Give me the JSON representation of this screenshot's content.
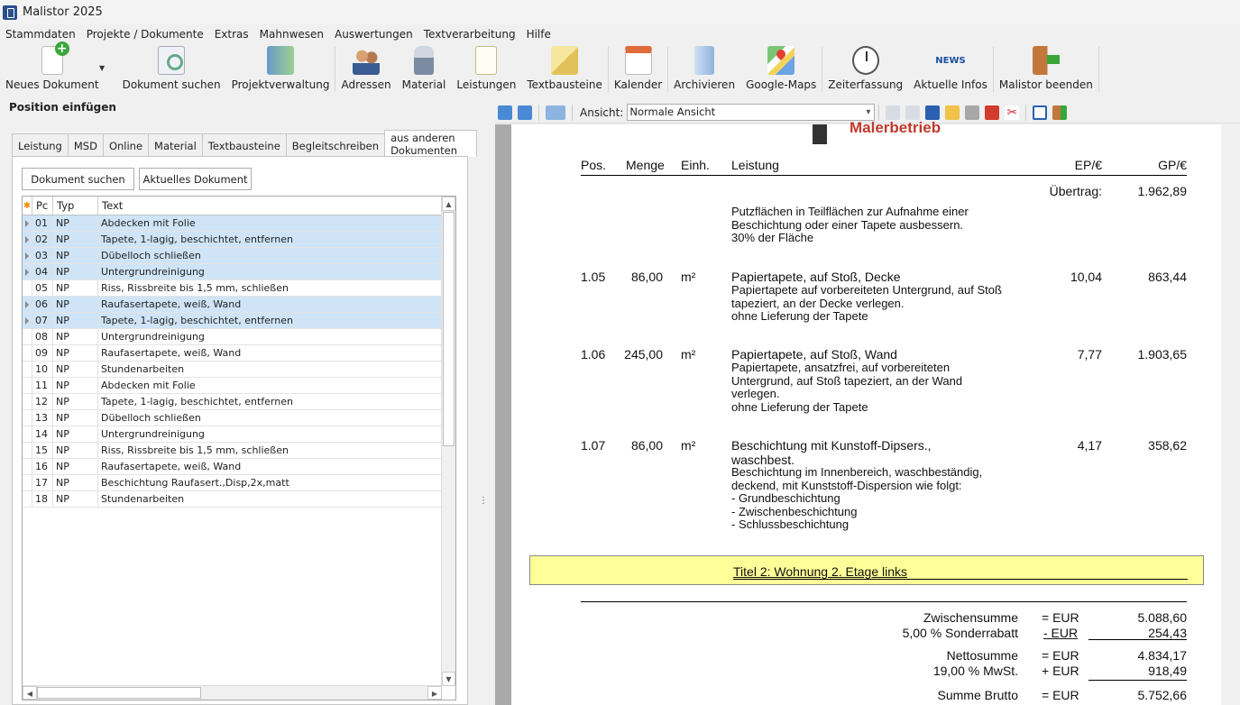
{
  "window": {
    "title": "Malistor 2025"
  },
  "menu": [
    "Stammdaten",
    "Projekte / Dokumente",
    "Extras",
    "Mahnwesen",
    "Auswertungen",
    "Textverarbeitung",
    "Hilfe"
  ],
  "ribbon": {
    "new_doc": "Neues Dokument",
    "search_doc": "Dokument suchen",
    "projects": "Projektverwaltung",
    "addresses": "Adressen",
    "material": "Material",
    "services": "Leistungen",
    "textblocks": "Textbausteine",
    "calendar": "Kalender",
    "archive": "Archivieren",
    "maps": "Google-Maps",
    "time": "Zeiterfassung",
    "news": "Aktuelle Infos",
    "news_icon": "NEWS",
    "exit": "Malistor beenden"
  },
  "left_panel": {
    "title": "Position einfügen",
    "tabs": [
      "Leistung",
      "MSD",
      "Online",
      "Material",
      "Textbausteine",
      "Begleitschreiben",
      "aus anderen Dokumenten"
    ],
    "search_button": "Dokument suchen",
    "current_button": "Aktuelles Dokument",
    "grid_headers": {
      "star": "✱",
      "pc": "Pc",
      "typ": "Typ",
      "text": "Text"
    },
    "rows": [
      {
        "pc": "01",
        "typ": "NP",
        "text": "Abdecken mit Folie",
        "selected": true
      },
      {
        "pc": "02",
        "typ": "NP",
        "text": "Tapete, 1-lagig, beschichtet, entfernen",
        "selected": true
      },
      {
        "pc": "03",
        "typ": "NP",
        "text": "Dübelloch schließen",
        "selected": true
      },
      {
        "pc": "04",
        "typ": "NP",
        "text": "Untergrundreinigung",
        "selected": true
      },
      {
        "pc": "05",
        "typ": "NP",
        "text": "Riss, Rissbreite bis 1,5 mm, schließen",
        "selected": false
      },
      {
        "pc": "06",
        "typ": "NP",
        "text": "Raufasertapete, weiß, Wand",
        "selected": true
      },
      {
        "pc": "07",
        "typ": "NP",
        "text": "Tapete, 1-lagig, beschichtet, entfernen",
        "selected": true
      },
      {
        "pc": "08",
        "typ": "NP",
        "text": "Untergrundreinigung",
        "selected": false
      },
      {
        "pc": "09",
        "typ": "NP",
        "text": "Raufasertapete, weiß, Wand",
        "selected": false
      },
      {
        "pc": "10",
        "typ": "NP",
        "text": "Stundenarbeiten",
        "selected": false
      },
      {
        "pc": "11",
        "typ": "NP",
        "text": "Abdecken mit Folie",
        "selected": false
      },
      {
        "pc": "12",
        "typ": "NP",
        "text": "Tapete, 1-lagig, beschichtet, entfernen",
        "selected": false
      },
      {
        "pc": "13",
        "typ": "NP",
        "text": "Dübelloch schließen",
        "selected": false
      },
      {
        "pc": "14",
        "typ": "NP",
        "text": "Untergrundreinigung",
        "selected": false
      },
      {
        "pc": "15",
        "typ": "NP",
        "text": "Riss, Rissbreite bis 1,5 mm, schließen",
        "selected": false
      },
      {
        "pc": "16",
        "typ": "NP",
        "text": "Raufasertapete, weiß, Wand",
        "selected": false
      },
      {
        "pc": "17",
        "typ": "NP",
        "text": "Beschichtung Raufasert.,Disp,2x,matt",
        "selected": false
      },
      {
        "pc": "18",
        "typ": "NP",
        "text": "Stundenarbeiten",
        "selected": false
      }
    ]
  },
  "doc_toolbar": {
    "view_label": "Ansicht:",
    "view_value": "Normale Ansicht"
  },
  "document": {
    "logo_text": "Malerbetrieb",
    "headers": {
      "pos": "Pos.",
      "menge": "Menge",
      "einh": "Einh.",
      "leistung": "Leistung",
      "ep": "EP/€",
      "gp": "GP/€"
    },
    "uebertrag_label": "Übertrag:",
    "uebertrag_value": "1.962,89",
    "carry_text": [
      "Putzflächen in Teilflächen zur Aufnahme einer",
      "Beschichtung oder einer Tapete ausbessern.",
      "30% der Fläche"
    ],
    "positions": [
      {
        "pos": "1.05",
        "menge": "86,00",
        "einh": "m²",
        "title": "Papiertapete, auf Stoß, Decke",
        "lines": [
          "Papiertapete auf vorbereiteten Untergrund, auf Stoß",
          "tapeziert, an der Decke verlegen.",
          "ohne Lieferung der Tapete"
        ],
        "ep": "10,04",
        "gp": "863,44"
      },
      {
        "pos": "1.06",
        "menge": "245,00",
        "einh": "m²",
        "title": "Papiertapete, auf Stoß, Wand",
        "lines": [
          "Papiertapete, ansatzfrei, auf vorbereiteten",
          "Untergrund, auf Stoß tapeziert, an der Wand",
          "verlegen.",
          "ohne Lieferung der Tapete"
        ],
        "ep": "7,77",
        "gp": "1.903,65"
      },
      {
        "pos": "1.07",
        "menge": "86,00",
        "einh": "m²",
        "title": "Beschichtung mit Kunstoff-Dipsers.,",
        "title2": "waschbest.",
        "lines": [
          "Beschichtung im Innenbereich, waschbeständig,",
          "deckend, mit Kunststoff-Dispersion wie folgt:",
          "- Grundbeschichtung",
          "- Zwischenbeschichtung",
          "- Schlussbeschichtung"
        ],
        "ep": "4,17",
        "gp": "358,62"
      }
    ],
    "section_title": "Titel 2: Wohnung 2. Etage links",
    "totals": [
      {
        "label": "Zwischensumme",
        "op": "= EUR",
        "value": "5.088,60"
      },
      {
        "label": "5,00 % Sonderrabatt",
        "op": "- EUR",
        "value": "254,43"
      },
      {
        "label": "Nettosumme",
        "op": "= EUR",
        "value": "4.834,17"
      },
      {
        "label": "19,00 % MwSt.",
        "op": "+ EUR",
        "value": "918,49"
      },
      {
        "label": "Summe Brutto",
        "op": "= EUR",
        "value": "5.752,66"
      }
    ]
  }
}
